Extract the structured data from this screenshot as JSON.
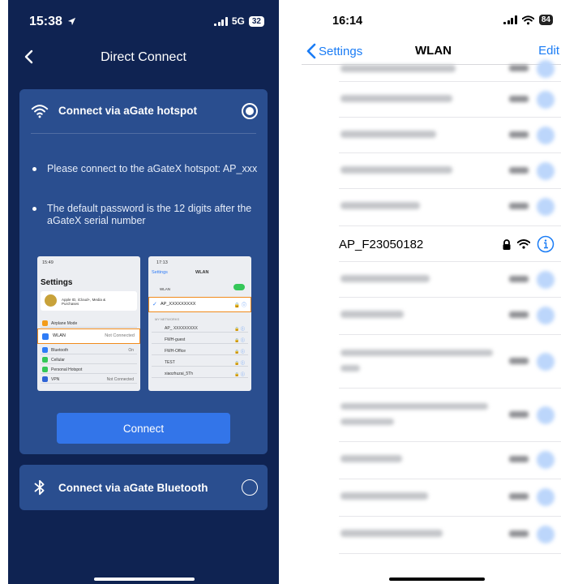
{
  "left_phone": {
    "status": {
      "time": "15:38",
      "network": "5G",
      "battery": "32"
    },
    "nav": {
      "title": "Direct Connect"
    },
    "hotspot_option": {
      "label": "Connect via aGate hotspot",
      "selected": true,
      "instructions": [
        "Please connect to the aGateX hotspot: AP_xxx",
        "The default password is the 12 digits after the aGateX serial number"
      ],
      "mini_screens": {
        "settings": {
          "time": "15:49",
          "title": "Settings",
          "profile": "Apple ID, iCloud+, Media & Purchases",
          "rows": [
            "Airplane Mode",
            "WLAN",
            "Bluetooth",
            "Cellular",
            "Personal Hotspot",
            "VPN"
          ],
          "wlan_value": "Not Connected",
          "bluetooth_value": "On",
          "vpn_value": "Not Connected"
        },
        "wlan": {
          "time": "17:13",
          "back": "Settings",
          "title": "WLAN",
          "wlan_label": "WLAN",
          "selected_network": "AP_XXXXXXXXX",
          "section": "MY NETWORKS",
          "networks": [
            "AP_ XXXXXXXXX",
            "FWH-guest",
            "FWH-Office",
            "TEST",
            "xiaozhuzai_5Th"
          ]
        }
      },
      "button_label": "Connect"
    },
    "bluetooth_option": {
      "label": "Connect via aGate Bluetooth",
      "selected": false
    }
  },
  "right_phone": {
    "status": {
      "time": "16:14",
      "battery": "84"
    },
    "nav": {
      "back_label": "Settings",
      "title": "WLAN",
      "edit_label": "Edit"
    },
    "visible_network": "AP_F23050182"
  },
  "colors": {
    "left_bg": "#0f2352",
    "card_bg": "#2a4e8f",
    "button_blue": "#3375e9",
    "ios_blue": "#1a7cf5",
    "highlight_orange": "#f08a1c"
  },
  "icons": [
    "chevron-left-icon",
    "wifi-icon",
    "bluetooth-icon",
    "lock-icon",
    "info-icon",
    "location-arrow-icon"
  ]
}
